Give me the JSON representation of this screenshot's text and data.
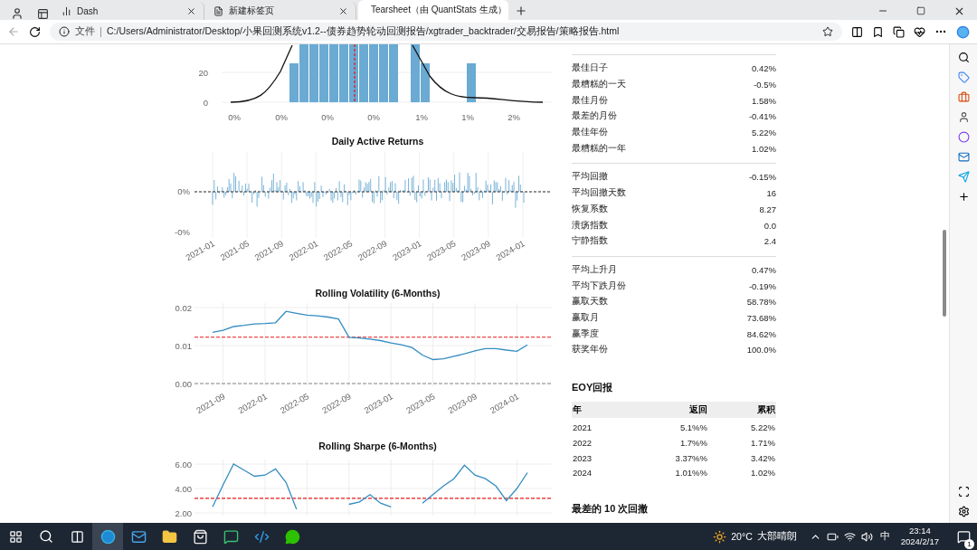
{
  "browser": {
    "tabs": [
      {
        "title": "Dash",
        "selected": false
      },
      {
        "title": "新建标签页",
        "selected": false
      },
      {
        "title": "Tearsheet（由 QuantStats 生成）",
        "selected": true
      }
    ],
    "address": {
      "scheme_label": "文件",
      "url": "C:/Users/Administrator/Desktop/小果回测系统v1.2--债券趋势轮动回测报告/xgtrader_backtrader/交易报告/策略报告.html"
    }
  },
  "histogram": {
    "yticks": [
      "20",
      "0"
    ],
    "xticks": [
      "0%",
      "0%",
      "0%",
      "0%",
      "1%",
      "1%",
      "2%"
    ]
  },
  "daily_active_returns": {
    "title": "Daily Active Returns",
    "yticks": [
      "0%",
      "-0%"
    ],
    "xticks": [
      "2021-01",
      "2021-05",
      "2021-09",
      "2022-01",
      "2022-05",
      "2022-09",
      "2023-01",
      "2023-05",
      "2023-09",
      "2024-01"
    ]
  },
  "rolling_volatility": {
    "chart_data": {
      "type": "line",
      "title": "Rolling Volatility (6-Months)",
      "categories": [
        null,
        "2021-09",
        null,
        null,
        null,
        "2022-01",
        null,
        null,
        null,
        "2022-05",
        null,
        null,
        null,
        "2022-09",
        null,
        null,
        null,
        "2023-01",
        null,
        null,
        null,
        "2023-05",
        null,
        null,
        null,
        "2023-09",
        null,
        null,
        null,
        "2024-01",
        null
      ],
      "series": [
        {
          "color": "#348dc1",
          "values": [
            0.0135,
            0.014,
            0.015,
            0.0153,
            0.0157,
            0.0158,
            0.016,
            0.019,
            0.0185,
            0.018,
            0.0178,
            0.0175,
            0.017,
            0.0122,
            0.012,
            0.0117,
            0.0113,
            0.0107,
            0.0102,
            0.0095,
            0.0075,
            0.0063,
            0.0065,
            0.0072,
            0.0078,
            0.0086,
            0.0092,
            0.0092,
            0.0088,
            0.0085,
            0.0102
          ]
        }
      ],
      "ylim": [
        0,
        0.02
      ],
      "yticks": [
        {
          "value": 0,
          "label": "0.00"
        },
        {
          "value": 0.01,
          "label": "0.01"
        },
        {
          "value": 0.02,
          "label": "0.02"
        }
      ],
      "grid": true,
      "ref_lines": [
        {
          "axis": "y",
          "value": 0.0122,
          "color": "#e41a1c"
        },
        {
          "axis": "y",
          "value": 0,
          "color": "#808080"
        }
      ]
    }
  },
  "rolling_sharpe": {
    "chart_data": {
      "type": "line",
      "title": "Rolling Sharpe (6-Months)",
      "categories": [
        null,
        null,
        null,
        null,
        null,
        null,
        null,
        null,
        null,
        null,
        null,
        null,
        null,
        null,
        null,
        null,
        null,
        null,
        null,
        null,
        null,
        null,
        null,
        null,
        null,
        null,
        null,
        null,
        null,
        null,
        null
      ],
      "series": [
        {
          "color": "#348dc1",
          "values": [
            2.5,
            4.3,
            6.0,
            5.5,
            5.0,
            5.1,
            5.6,
            4.5,
            2.3,
            null,
            null,
            null,
            null,
            2.7,
            2.9,
            3.5,
            2.8,
            2.5,
            null,
            null,
            2.8,
            3.5,
            4.2,
            4.8,
            5.9,
            5.1,
            4.8,
            4.2,
            3.0,
            4.0,
            5.3
          ]
        }
      ],
      "ylim": [
        2,
        6
      ],
      "yticks": [
        {
          "value": 2,
          "label": "2.00"
        },
        {
          "value": 4,
          "label": "4.00"
        },
        {
          "value": 6,
          "label": "6.00"
        }
      ],
      "grid": true,
      "ref_lines": [
        {
          "axis": "y",
          "value": 3.2,
          "color": "#e41a1c"
        }
      ]
    }
  },
  "metrics": {
    "groups": [
      [
        {
          "label": "最佳日子",
          "value": "0.42%"
        },
        {
          "label": "最糟糕的一天",
          "value": "-0.5%"
        },
        {
          "label": "最佳月份",
          "value": "1.58%"
        },
        {
          "label": "最差的月份",
          "value": "-0.41%"
        },
        {
          "label": "最佳年份",
          "value": "5.22%"
        },
        {
          "label": "最糟糕的一年",
          "value": "1.02%"
        }
      ],
      [
        {
          "label": "平均回撤",
          "value": "-0.15%"
        },
        {
          "label": "平均回撤天数",
          "value": "16"
        },
        {
          "label": "恢复系数",
          "value": "8.27"
        },
        {
          "label": "溃疡指数",
          "value": "0.0"
        },
        {
          "label": "宁静指数",
          "value": "2.4"
        }
      ],
      [
        {
          "label": "平均上升月",
          "value": "0.47%"
        },
        {
          "label": "平均下跌月份",
          "value": "-0.19%"
        },
        {
          "label": "赢取天数",
          "value": "58.78%"
        },
        {
          "label": "赢取月",
          "value": "73.68%"
        },
        {
          "label": "赢季度",
          "value": "84.62%"
        },
        {
          "label": "获奖年份",
          "value": "100.0%"
        }
      ]
    ]
  },
  "eoy": {
    "title": "EOY回报",
    "columns": [
      "年",
      "返回",
      "累积"
    ],
    "rows": [
      [
        "2021",
        "5.1%%",
        "5.22%"
      ],
      [
        "2022",
        "1.7%%",
        "1.71%"
      ],
      [
        "2023",
        "3.37%%",
        "3.42%"
      ],
      [
        "2024",
        "1.01%%",
        "1.02%"
      ]
    ]
  },
  "next_section_title": "最差的 10 次回撤",
  "taskbar": {
    "apps": [
      {
        "kind": "edge",
        "selected": true
      },
      {
        "kind": "mail",
        "selected": false
      },
      {
        "kind": "folder",
        "selected": false
      },
      {
        "kind": "store",
        "selected": false
      },
      {
        "kind": "chat",
        "selected": false
      },
      {
        "kind": "code",
        "selected": false
      },
      {
        "kind": "wechat",
        "selected": false
      }
    ],
    "temperature": "20°C",
    "weather": "大部晴朗",
    "ime": "中",
    "time": "23:14",
    "date": "2024/2/17",
    "notifications": "1"
  }
}
